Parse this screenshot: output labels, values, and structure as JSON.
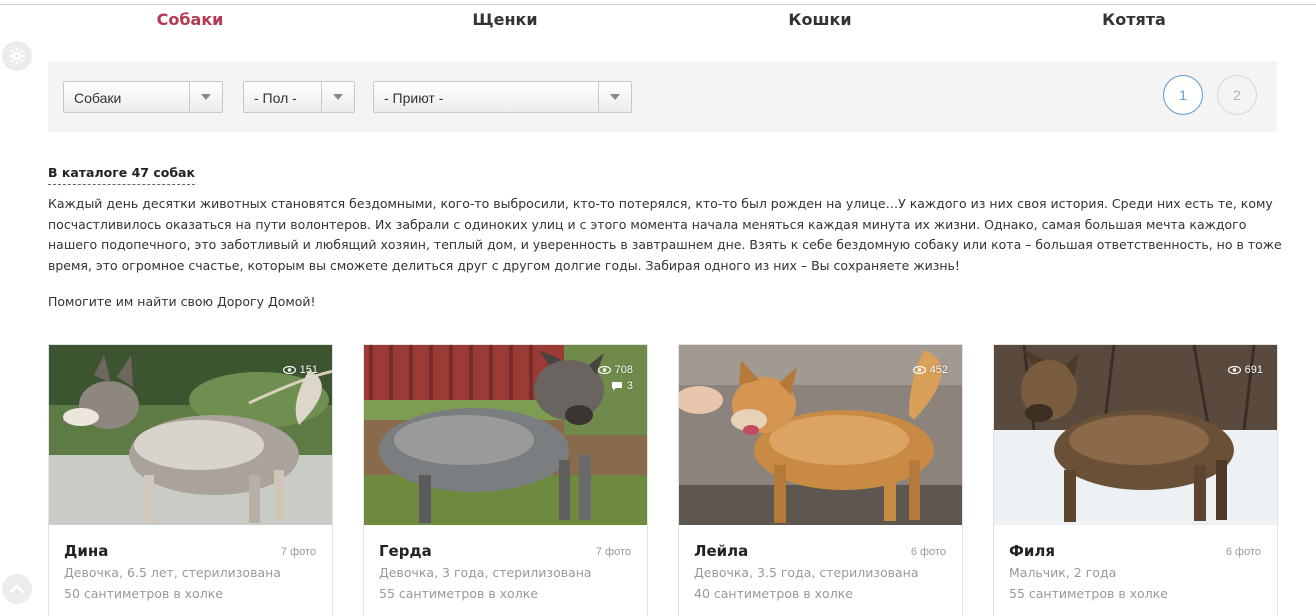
{
  "nav": {
    "tabs": [
      {
        "label": "Собаки",
        "active": true
      },
      {
        "label": "Щенки",
        "active": false
      },
      {
        "label": "Кошки",
        "active": false
      },
      {
        "label": "Котята",
        "active": false
      }
    ]
  },
  "side_buttons": {
    "settings_icon": "gear-icon",
    "scroll_up_icon": "chevron-up-icon"
  },
  "filters": {
    "type_value": "Собаки",
    "sex_value": "- Пол -",
    "shelter_value": "- Приют -"
  },
  "pagination": {
    "pages": [
      "1",
      "2"
    ],
    "current": "1"
  },
  "catalog": {
    "title": "В каталоге 47 собак",
    "intro": "Каждый день десятки животных становятся бездомными, кого-то выбросили, кто-то потерялся, кто-то был рожден на улице…У каждого из них своя история. Среди них есть те, кому посчастливилось оказаться на пути волонтеров. Их забрали с одиноких улиц и с этого момента начала меняться каждая минута их жизни. Однако, самая большая мечта каждого нашего подопечного, это заботливый и любящий хозяин, теплый дом, и уверенность в завтрашнем дне. Взять к себе бездомную собаку или кота – большая ответственность, но в тоже время, это огромное счастье, которым вы сможете делиться друг с другом долгие годы. Забирая одного из них – Вы сохраняете жизнь!",
    "help_text": "Помогите им найти свою Дорогу Домой!"
  },
  "pets": [
    {
      "name": "Дина",
      "photos": "7 фото",
      "desc": "Девочка, 6.5 лет, стерилизована",
      "size": "50 сантиметров в холке",
      "views": "151",
      "comments": ""
    },
    {
      "name": "Герда",
      "photos": "7 фото",
      "desc": "Девочка, 3 года, стерилизована",
      "size": "55 сантиметров в холке",
      "views": "708",
      "comments": "3"
    },
    {
      "name": "Лейла",
      "photos": "6 фото",
      "desc": "Девочка, 3.5 года, стерилизована",
      "size": "40 сантиметров в холке",
      "views": "452",
      "comments": ""
    },
    {
      "name": "Филя",
      "photos": "6 фото",
      "desc": "Мальчик, 2 года",
      "size": "55 сантиметров в холке",
      "views": "691",
      "comments": ""
    }
  ],
  "colors": {
    "accent": "#b23a52",
    "pager": "#5b9bd5",
    "panel": "#f4f4f4"
  }
}
